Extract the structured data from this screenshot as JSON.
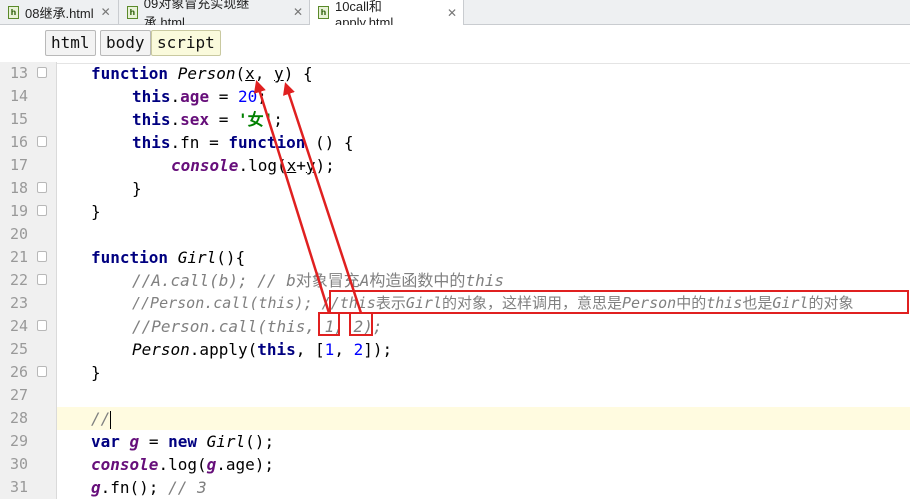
{
  "tabs": [
    {
      "label": "08继承.html",
      "active": false
    },
    {
      "label": "09对象冒充实现继承.html",
      "active": false
    },
    {
      "label": "10call和apply.html",
      "active": true
    }
  ],
  "breadcrumb": [
    "html",
    "body",
    "script"
  ],
  "gutter": {
    "line_numbers": [
      "13",
      "14",
      "15",
      "16",
      "17",
      "18",
      "19",
      "20",
      "21",
      "22",
      "23",
      "24",
      "25",
      "26",
      "27",
      "28",
      "29",
      "30",
      "31"
    ]
  },
  "code": {
    "l13": {
      "a": "function",
      "b": "Person",
      "c": "(",
      "d": "x",
      "e": ", ",
      "f": "y",
      "g": ") {"
    },
    "l14": {
      "a": "this",
      "b": ".",
      "c": "age",
      "d": " = ",
      "e": "20",
      "f": ";"
    },
    "l15": {
      "a": "this",
      "b": ".",
      "c": "sex",
      "d": " = ",
      "e": "'女'",
      "f": ";"
    },
    "l16": {
      "a": "this",
      "b": ".fn = ",
      "c": "function",
      "d": " () {"
    },
    "l17": {
      "a": "console",
      "b": ".log(",
      "c": "x",
      "d": "+",
      "e": "y",
      "f": ");"
    },
    "l18": {
      "a": "}"
    },
    "l19": {
      "a": "}"
    },
    "l21": {
      "a": "function",
      "b": "Girl",
      "c": "(){"
    },
    "l22": {
      "a": "//A.call(b); // b",
      "b": "对象冒充",
      "c": "A",
      "d": "构造函数中的",
      "e": "this"
    },
    "l23": {
      "a": "//Person.call(this); //this",
      "b": "表示",
      "c": "Girl",
      "d": "的对象，这样调用，意思是",
      "e": "Person",
      "f": "中的",
      "g": "this",
      "h": "也是",
      "i": "Girl",
      "j": "的对象"
    },
    "l24": {
      "a": "//Person.call(this, 1, 2);"
    },
    "l25": {
      "a": "Person",
      "b": ".apply(",
      "c": "this",
      "d": ", [",
      "e": "1",
      "f": ", ",
      "g": "2",
      "h": "]);"
    },
    "l26": {
      "a": "}"
    },
    "l28": {
      "a": "//"
    },
    "l29": {
      "a": "var",
      "b": "g",
      "c": " = ",
      "d": "new",
      "e": "Girl",
      "f": "();"
    },
    "l30": {
      "a": "console",
      "b": ".log(",
      "c": "g",
      "d": ".age);"
    },
    "l31": {
      "a": "g",
      "b": ".fn(); ",
      "c": "// 3"
    }
  },
  "colors": {
    "annotation": "#e02020",
    "keyword": "#000080",
    "member": "#660e7a",
    "number": "#0000ff",
    "string": "#008000",
    "comment": "#808080"
  }
}
